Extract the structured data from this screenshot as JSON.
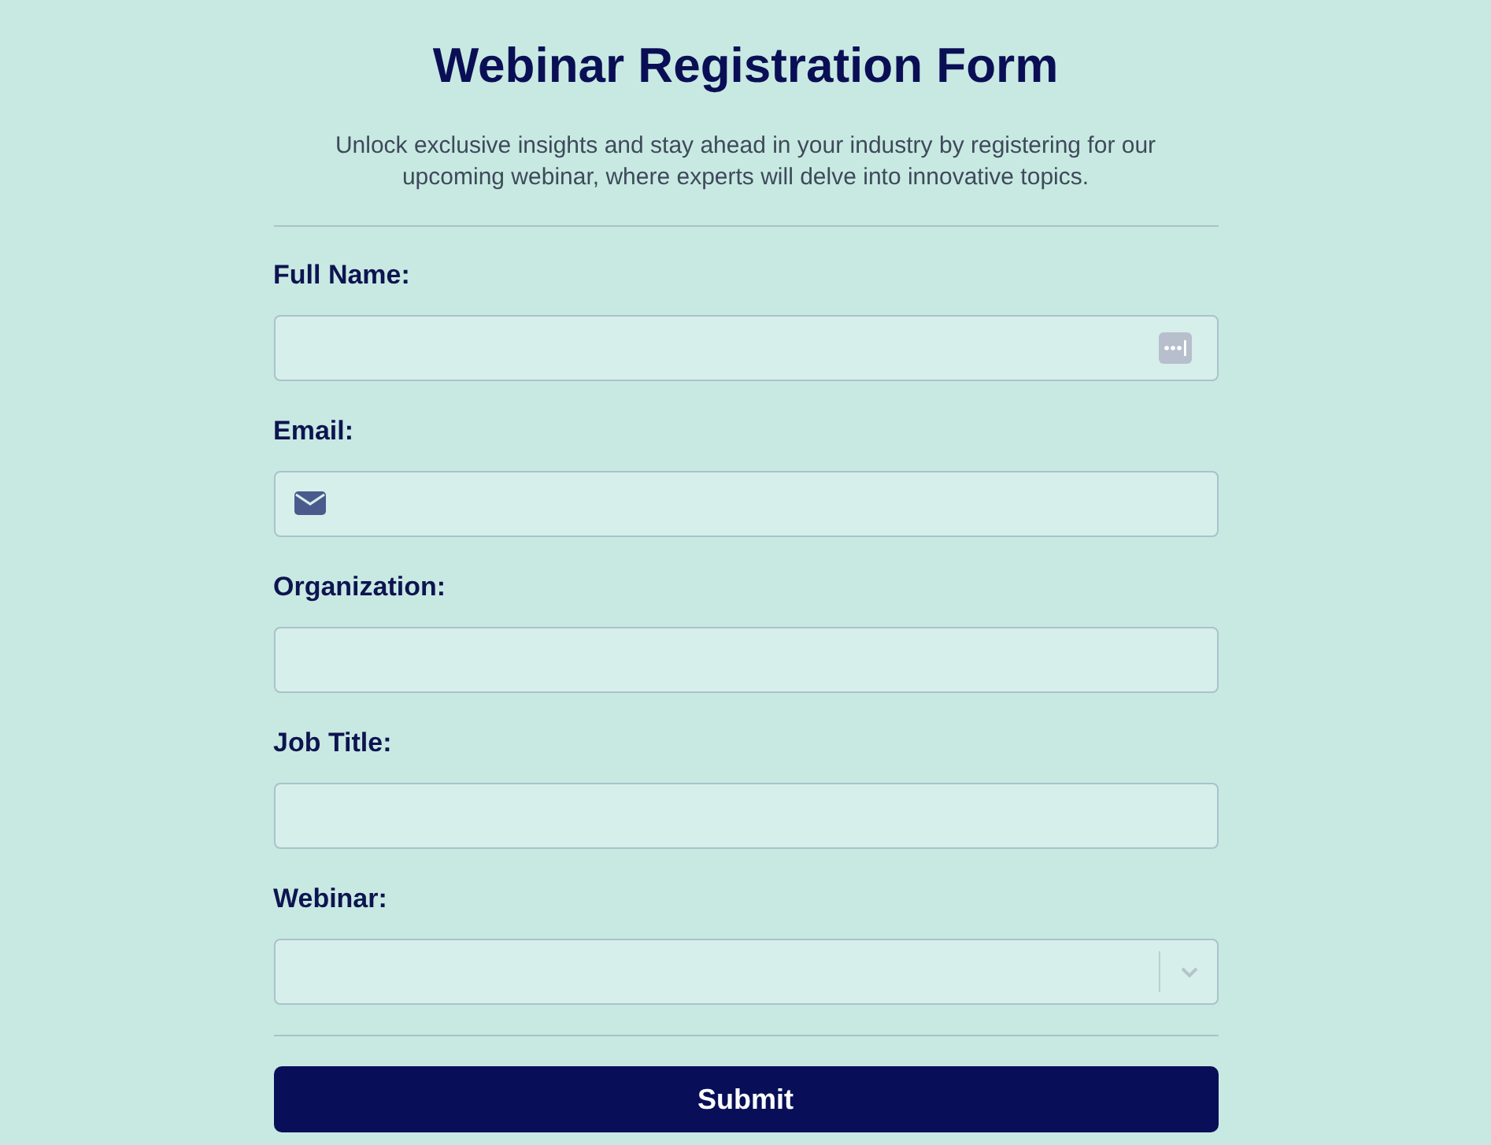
{
  "title": "Webinar Registration Form",
  "description": "Unlock exclusive insights and stay ahead in your industry by registering for our upcoming webinar, where experts will delve into innovative topics.",
  "fields": [
    {
      "kind": "name",
      "label": "Full Name:"
    },
    {
      "kind": "email",
      "label": "Email:"
    },
    {
      "kind": "text",
      "label": "Organization:"
    },
    {
      "kind": "text",
      "label": "Job Title:"
    },
    {
      "kind": "select",
      "label": "Webinar:"
    }
  ],
  "submit": {
    "label": "Submit"
  }
}
